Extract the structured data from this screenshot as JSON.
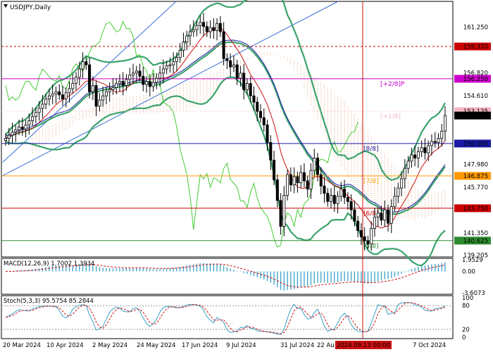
{
  "chart_data": {
    "type": "candlestick",
    "symbol_label": "USDJPY,Daily",
    "timeframe": "Daily",
    "y_range": [
      139.25,
      162.5
    ],
    "price_ticks": [
      "161.250",
      "159.370",
      "156.820",
      "156.250",
      "154.610",
      "153.125",
      "152.703",
      "150.000",
      "147.980",
      "146.875",
      "145.770",
      "143.750",
      "141.350",
      "140.625",
      "139.205"
    ],
    "price_tick_values": [
      161.25,
      159.37,
      156.82,
      156.25,
      154.61,
      153.125,
      152.703,
      150.0,
      147.98,
      146.875,
      145.77,
      143.75,
      141.35,
      140.625,
      139.205
    ],
    "highlight_ticks": {
      "159.370": "#cc0000",
      "156.250": "#cc00cc",
      "153.125": "#f4b6c2",
      "152.703": "#000000",
      "150.000": "#1a1aa6",
      "146.875": "#ff9900",
      "143.750": "#cc0000",
      "140.625": "#2e8b2e"
    },
    "murrey_levels": [
      {
        "label": "[+2/8]P",
        "value": 156.25,
        "color": "#cc00cc"
      },
      {
        "label": "[+1/8]",
        "value": 153.125,
        "color": "#f4b6c2"
      },
      {
        "label": "[8/8]",
        "value": 150.0,
        "color": "#1a1aa6"
      },
      {
        "label": "[7/8]",
        "value": 146.875,
        "color": "#ff9900"
      },
      {
        "label": "[6/8]",
        "value": 143.75,
        "color": "#cc0000"
      },
      {
        "label": "[5/8]",
        "value": 140.625,
        "color": "#2e8b2e"
      }
    ],
    "dashed_level": {
      "value": 159.37,
      "color": "#cc0000"
    },
    "vertical_marker_label": "2024.09.13 00:00",
    "x_ticks": [
      "20 Mar 2024",
      "10 Apr 2024",
      "2 May 2024",
      "24 May 2024",
      "17 Jun 2024",
      "9 Jul 2024",
      "31 Jul 2024",
      "22 Au",
      "24",
      "7 Oct 2024"
    ],
    "close_series": [
      150.5,
      150.8,
      151.1,
      151.3,
      151.6,
      151.4,
      151.8,
      152.2,
      152.6,
      153.0,
      153.4,
      153.8,
      154.3,
      154.6,
      154.8,
      155.0,
      154.7,
      154.3,
      154.9,
      155.3,
      155.8,
      156.4,
      157.2,
      157.9,
      157.6,
      155.0,
      155.6,
      153.6,
      154.2,
      154.6,
      155.0,
      155.2,
      155.4,
      155.8,
      156.0,
      155.6,
      156.2,
      156.6,
      156.8,
      157.0,
      156.5,
      155.7,
      156.0,
      155.5,
      155.9,
      156.3,
      156.8,
      157.2,
      157.5,
      157.6,
      157.9,
      158.3,
      159.0,
      159.8,
      160.4,
      160.8,
      161.0,
      161.4,
      161.7,
      161.3,
      160.8,
      161.2,
      160.9,
      161.6,
      160.8,
      158.2,
      158.0,
      157.4,
      157.6,
      156.3,
      156.8,
      155.2,
      155.8,
      154.6,
      154.0,
      153.1,
      152.5,
      151.8,
      150.1,
      148.4,
      146.5,
      144.5,
      142.0,
      145.0,
      147.0,
      146.0,
      146.8,
      146.2,
      147.2,
      146.4,
      145.6,
      147.4,
      148.6,
      147.0,
      145.9,
      145.2,
      144.4,
      145.0,
      144.2,
      144.9,
      145.6,
      144.8,
      144.4,
      143.6,
      142.5,
      141.6,
      141.0,
      140.6,
      140.3,
      141.8,
      142.9,
      143.3,
      142.6,
      143.6,
      142.3,
      143.9,
      144.9,
      145.7,
      146.6,
      147.6,
      148.3,
      148.9,
      148.6,
      149.2,
      149.6,
      149.1,
      149.8,
      150.2,
      150.1,
      150.5,
      151.2,
      152.7
    ],
    "macd": {
      "label": "MACD(12,26,9) 1.7002 1.3934",
      "ticks": [
        "1.9529",
        "0.00",
        "-3.6073"
      ],
      "range": [
        -3.6073,
        1.9529
      ]
    },
    "stoch": {
      "label": "Stoch(5,3,3) 95.5754 85.2844",
      "ticks": [
        "100",
        "80",
        "20",
        "0"
      ],
      "range": [
        0,
        100
      ]
    }
  }
}
